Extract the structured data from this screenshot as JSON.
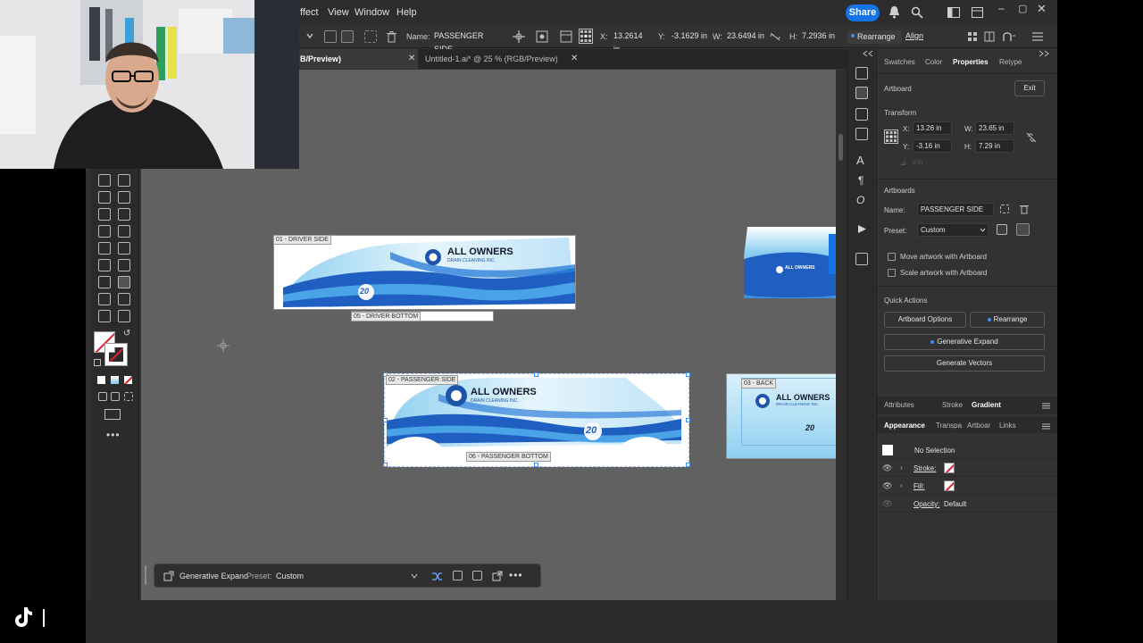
{
  "menu": {
    "items": [
      "ffect",
      "View",
      "Window",
      "Help"
    ],
    "share_label": "Share"
  },
  "control_bar": {
    "name_label": "Name:",
    "name_value": "PASSENGER SIDE",
    "x_label": "X:",
    "x_value": "13.2614 in",
    "y_label": "Y:",
    "y_value": "-3.1629 in",
    "w_label": "W:",
    "w_value": "23.6494 in",
    "h_label": "H:",
    "h_value": "7.2936 in",
    "rearrange_label": "Rearrange",
    "align_label": "Align"
  },
  "tabs": {
    "active": "B/Preview)",
    "inactive": "Untitled-1.ai* @ 25 % (RGB/Preview)"
  },
  "artboards": {
    "driver_side": "01 - DRIVER SIDE",
    "driver_bottom": "05 - DRIVER BOTTOM",
    "passenger_side": "02 - PASSENGER SIDE",
    "passenger_bottom": "06 - PASSENGER BOTTOM",
    "back": "03 - BACK"
  },
  "artwork": {
    "brand_line1": "ALL OWNERS",
    "brand_line2": "DRAIN CLEANING INC.",
    "badge": "20",
    "front_logo": "ALL OWNERS"
  },
  "properties_panel": {
    "tabs": [
      "Swatches",
      "Color",
      "Properties",
      "Retype"
    ],
    "active_tab": "Properties",
    "section_artboard": "Artboard",
    "exit_label": "Exit",
    "transform_heading": "Transform",
    "x_label": "X:",
    "x_value": "13.26 in",
    "y_label": "Y:",
    "y_value": "-3.16 in",
    "w_label": "W:",
    "w_value": "23.65 in",
    "h_label": "H:",
    "h_value": "7.29 in",
    "rotate_value": "0 in",
    "artboards_heading": "Artboards",
    "name_label": "Name:",
    "name_value": "PASSENGER SIDE",
    "preset_label": "Preset:",
    "preset_value": "Custom",
    "move_artwork": "Move artwork with Artboard",
    "scale_artwork": "Scale artwork with Artboard",
    "quick_actions": "Quick Actions",
    "artboard_options": "Artboard Options",
    "rearrange": "Rearrange",
    "generative_expand": "Generative Expand",
    "generate_vectors": "Generate Vectors"
  },
  "attributes_tabs": [
    "Attributes",
    "Stroke",
    "Gradient"
  ],
  "appearance": {
    "tabs": [
      "Appearance",
      "Transpa",
      "Artboar",
      "Links"
    ],
    "no_selection": "No Selection",
    "stroke_label": "Stroke:",
    "fill_label": "Fill:",
    "opacity_label": "Opacity:",
    "opacity_value": "Default"
  },
  "context_bar": {
    "generative_expand": "Generative Expand",
    "preset_label": "Preset:",
    "preset_value": "Custom"
  },
  "colors": {
    "accent": "#1473e6",
    "canvas": "#616161",
    "panel": "#323232",
    "wrap_blue": "#1f5fc2",
    "wrap_light": "#bfe3f7"
  }
}
